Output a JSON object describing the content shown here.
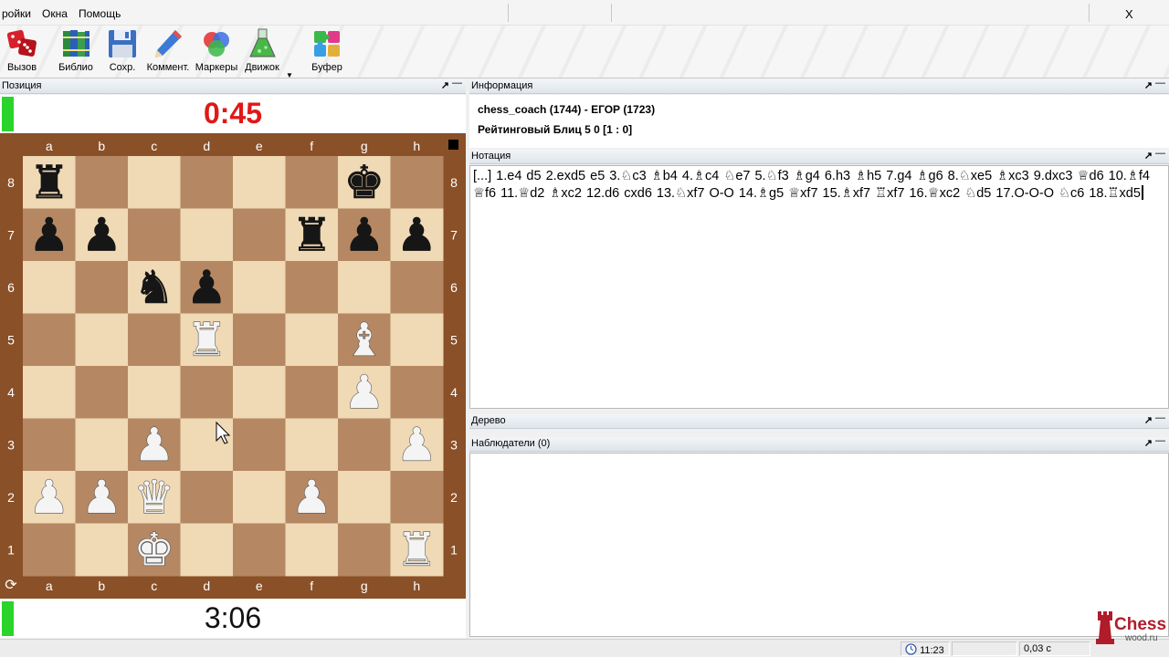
{
  "menu": {
    "items": [
      "ройки",
      "Окна",
      "Помощь"
    ],
    "close": "X"
  },
  "toolbar": {
    "buttons": [
      {
        "label": "Вызов",
        "icon": "dice-icon"
      },
      {
        "label": "Библио",
        "icon": "books-icon"
      },
      {
        "label": "Сохр.",
        "icon": "floppy-disk-icon"
      },
      {
        "label": "Коммент.",
        "icon": "pencil-icon"
      },
      {
        "label": "Маркеры",
        "icon": "color-circles-icon"
      },
      {
        "label": "Движок",
        "icon": "flask-icon"
      },
      {
        "label": "Буфер",
        "icon": "puzzle-icon"
      }
    ],
    "dropdown_arrow": "▼"
  },
  "position_panel": {
    "title": "Позиция",
    "pin": "↗",
    "minimize": "—"
  },
  "clock_top": {
    "time": "0:45"
  },
  "clock_bottom": {
    "time": "3:06"
  },
  "board": {
    "files": [
      "a",
      "b",
      "c",
      "d",
      "e",
      "f",
      "g",
      "h"
    ],
    "ranks": [
      "8",
      "7",
      "6",
      "5",
      "4",
      "3",
      "2",
      "1"
    ],
    "light_color": "#f0d9b5",
    "dark_color": "#b58863",
    "frame_color": "#8a5028",
    "side_to_move": "black",
    "pieces": [
      {
        "square": "a8",
        "glyph": "♜",
        "color": "black"
      },
      {
        "square": "g8",
        "glyph": "♚",
        "color": "black"
      },
      {
        "square": "a7",
        "glyph": "♟",
        "color": "black"
      },
      {
        "square": "b7",
        "glyph": "♟",
        "color": "black"
      },
      {
        "square": "f7",
        "glyph": "♜",
        "color": "black"
      },
      {
        "square": "g7",
        "glyph": "♟",
        "color": "black"
      },
      {
        "square": "h7",
        "glyph": "♟",
        "color": "black"
      },
      {
        "square": "c6",
        "glyph": "♞",
        "color": "black"
      },
      {
        "square": "d6",
        "glyph": "♟",
        "color": "black"
      },
      {
        "square": "d5",
        "glyph": "♜",
        "color": "white"
      },
      {
        "square": "g5",
        "glyph": "♝",
        "color": "white"
      },
      {
        "square": "g4",
        "glyph": "♟",
        "color": "white"
      },
      {
        "square": "c3",
        "glyph": "♟",
        "color": "white"
      },
      {
        "square": "h3",
        "glyph": "♟",
        "color": "white"
      },
      {
        "square": "a2",
        "glyph": "♟",
        "color": "white"
      },
      {
        "square": "b2",
        "glyph": "♟",
        "color": "white"
      },
      {
        "square": "c2",
        "glyph": "♛",
        "color": "white"
      },
      {
        "square": "f2",
        "glyph": "♟",
        "color": "white"
      },
      {
        "square": "c1",
        "glyph": "♚",
        "color": "white"
      },
      {
        "square": "h1",
        "glyph": "♜",
        "color": "white"
      }
    ]
  },
  "info_panel": {
    "title": "Информация",
    "players": "chess_coach (1744) - ЕГОР (1723)",
    "game_type": "Рейтинговый Блиц 5 0 [1 : 0]",
    "pin": "↗",
    "minimize": "—"
  },
  "notation_panel": {
    "title": "Нотация",
    "text": "[...] 1.e4 d5 2.exd5 e5 3.♘c3 ♗b4 4.♗c4 ♘e7 5.♘f3 ♗g4 6.h3 ♗h5 7.g4 ♗g6 8.♘xe5 ♗xc3 9.dxc3 ♕d6 10.♗f4 ♕f6 11.♕d2 ♗xc2 12.d6 cxd6 13.♘xf7 O-O 14.♗g5 ♕xf7 15.♗xf7 ♖xf7 16.♕xc2 ♘d5 17.O-O-O ♘c6 18.♖xd5",
    "pin": "↗",
    "minimize": "—"
  },
  "tree_panel": {
    "title": "Дерево",
    "pin": "↗",
    "minimize": "—"
  },
  "watchers_panel": {
    "title": "Наблюдатели (0)",
    "pin": "↗",
    "minimize": "—"
  },
  "statusbar": {
    "time": "11:23",
    "value": "0,03 с"
  },
  "logo": {
    "text": "Chess",
    "subtext": "wood.ru"
  }
}
